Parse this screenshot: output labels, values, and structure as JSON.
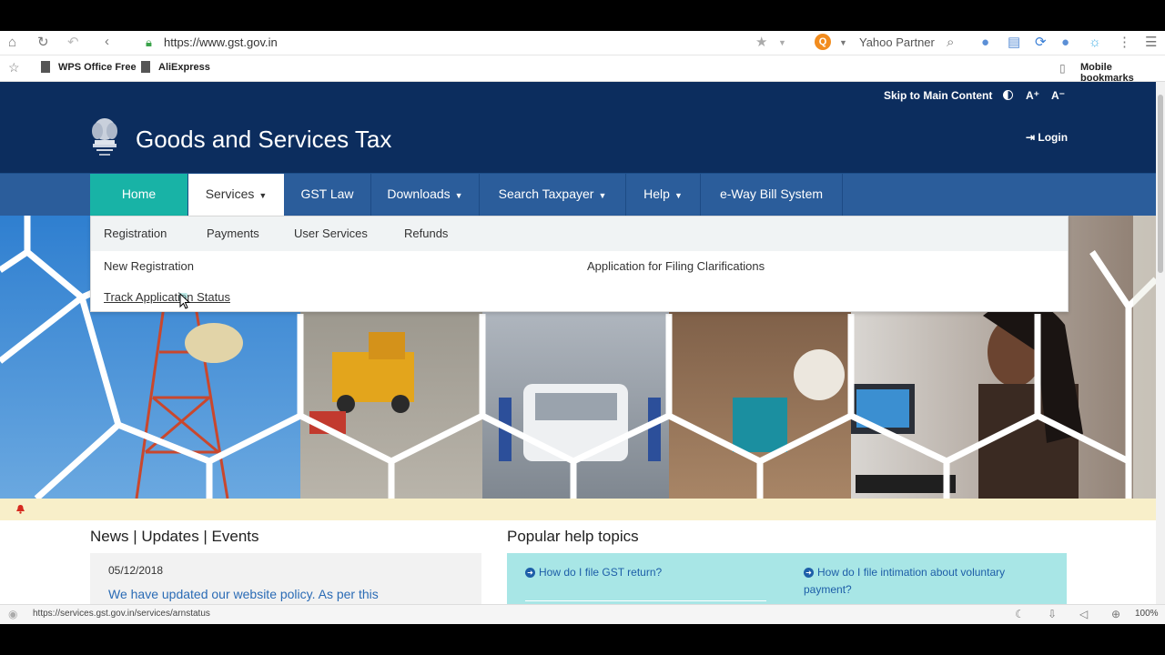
{
  "browser": {
    "url": "https://www.gst.gov.in",
    "search_engine_label": "Yahoo Partner",
    "bookmarks": [
      "WPS Office Free",
      "AliExpress"
    ],
    "mobile_bookmarks": "Mobile bookmarks",
    "status_url": "https://services.gst.gov.in/services/arnstatus",
    "zoom": "100%"
  },
  "header": {
    "skip_link": "Skip to Main Content",
    "font_increase": "A⁺",
    "font_decrease": "A⁻",
    "title": "Goods and Services Tax",
    "login": "Login"
  },
  "nav": {
    "items": [
      "Home",
      "Services",
      "GST Law",
      "Downloads",
      "Search Taxpayer",
      "Help",
      "e-Way Bill System"
    ]
  },
  "services_menu": {
    "tabs": [
      "Registration",
      "Payments",
      "User Services",
      "Refunds"
    ],
    "links": [
      "New Registration",
      "Track Application Status",
      "Application for Filing Clarifications"
    ]
  },
  "news": {
    "heading": "News | Updates | Events",
    "date": "05/12/2018",
    "text": "We have updated our website policy. As per this"
  },
  "help": {
    "heading": "Popular help topics",
    "links": [
      "How do I file GST return?",
      "How do I file intimation about voluntary payment?"
    ]
  },
  "colors": {
    "header_bg": "#0c2d5e",
    "nav_bg": "#2b5d9b",
    "home_tab": "#18b3a6",
    "help_card": "#a8e6e6",
    "alert_bar": "#f8efc9"
  },
  "icons": [
    "home-icon",
    "reload-icon",
    "undo-icon",
    "back-icon",
    "lock-icon",
    "star-icon",
    "search-icon",
    "menu-icon",
    "bell-icon",
    "contrast-icon",
    "login-icon",
    "emblem-icon"
  ]
}
